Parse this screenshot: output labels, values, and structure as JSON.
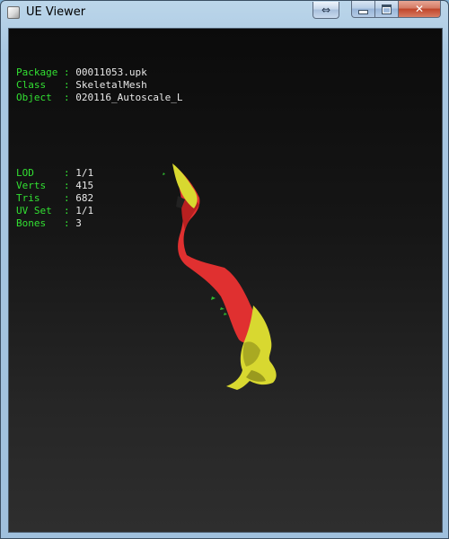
{
  "window": {
    "title": "UE Viewer",
    "controls": {
      "restore": "⇔",
      "minimize": "",
      "maximize": "",
      "close": "✕"
    }
  },
  "info_top": [
    {
      "label": "Package",
      "sep": " : ",
      "value": "00011053.upk"
    },
    {
      "label": "Class  ",
      "sep": " : ",
      "value": "SkeletalMesh"
    },
    {
      "label": "Object ",
      "sep": " : ",
      "value": "020116_Autoscale_L"
    }
  ],
  "info_bottom": [
    {
      "label": "LOD    ",
      "sep": " : ",
      "value": "1/1"
    },
    {
      "label": "Verts  ",
      "sep": " : ",
      "value": "415"
    },
    {
      "label": "Tris   ",
      "sep": " : ",
      "value": "682"
    },
    {
      "label": "UV Set ",
      "sep": " : ",
      "value": "1/1"
    },
    {
      "label": "Bones  ",
      "sep": " : ",
      "value": "3"
    }
  ],
  "colors": {
    "label": "#32e032",
    "value": "#e8e8e8",
    "mesh_primary": "#e03030",
    "mesh_secondary": "#d8d830"
  }
}
